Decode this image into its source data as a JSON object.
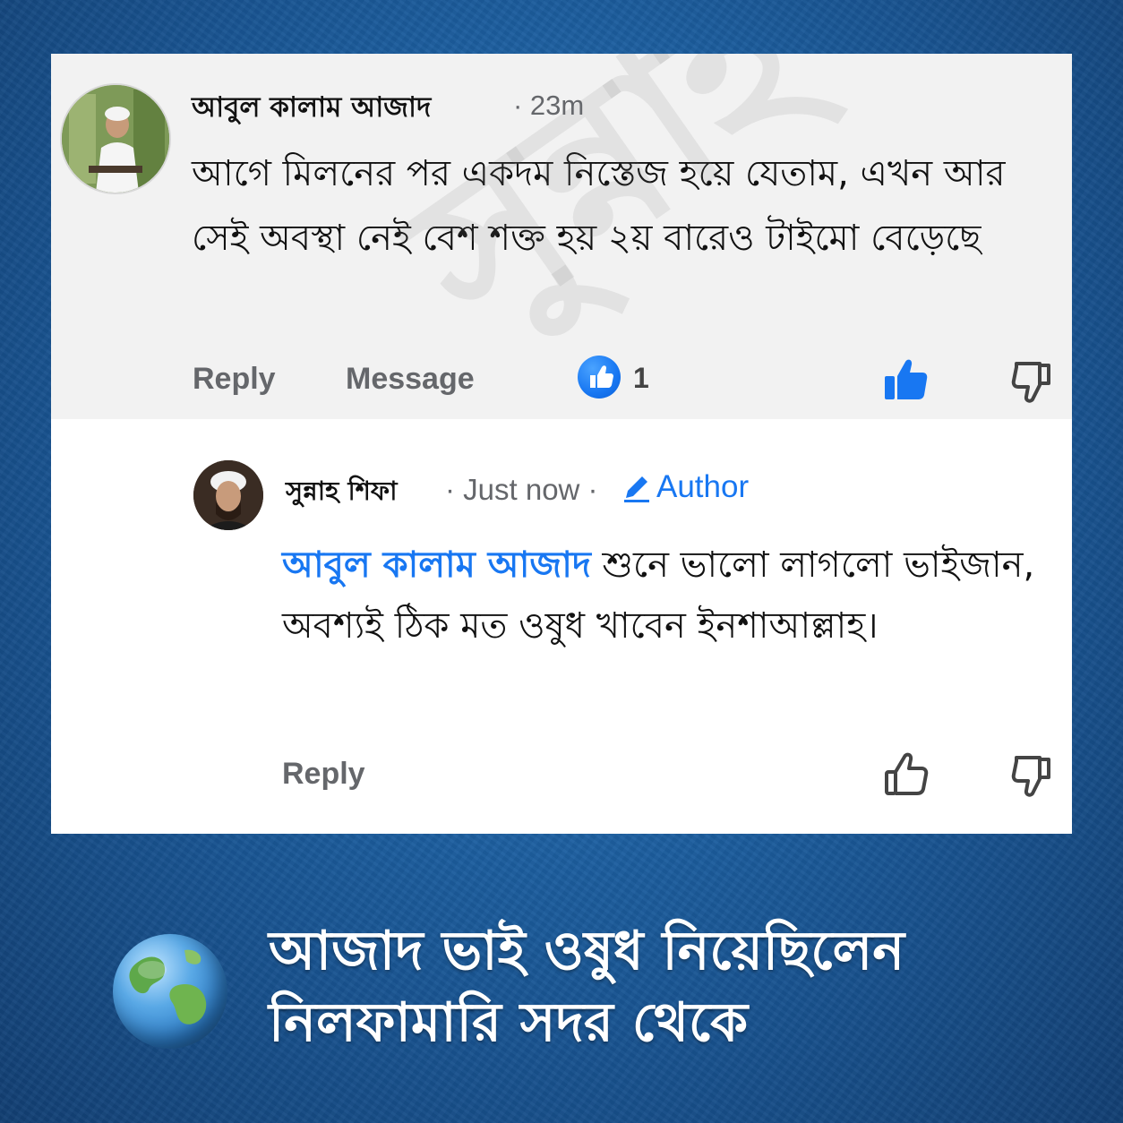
{
  "background": {
    "color": "#1c5d9e"
  },
  "watermark": {
    "text": "সুন্নাহ শিফা"
  },
  "comment": {
    "author": "আবুল কালাম আজাদ",
    "time": "· 23m",
    "text": "আগে মিলনের পর একদম নিস্তেজ হয়ে যেতাম, এখন আর সেই অবস্থা নেই বেশ শক্ত হয় ২য় বারেও টাইমো বেড়েছে",
    "actions": {
      "reply": "Reply",
      "message": "Message",
      "like_count": "1"
    }
  },
  "reply": {
    "author": "সুন্নাহ শিফা",
    "time": "· Just now ·",
    "badge": "Author",
    "mention": "আবুল কালাম আজাদ",
    "text": " শুনে ভালো লাগলো ভাইজান,  অবশ্যই ঠিক মত ওষুধ খাবেন ইনশাআল্লাহ।",
    "actions": {
      "reply": "Reply"
    }
  },
  "caption": {
    "line1": "আজাদ ভাই ওষুধ নিয়েছিলেন",
    "line2": "নিলফামারি সদর থেকে"
  },
  "colors": {
    "accent": "#1877f2",
    "muted": "#65676b",
    "text": "#111111"
  },
  "icons": [
    "like-icon",
    "thumbs-up-icon",
    "thumbs-down-icon",
    "pencil-icon",
    "globe-icon"
  ]
}
